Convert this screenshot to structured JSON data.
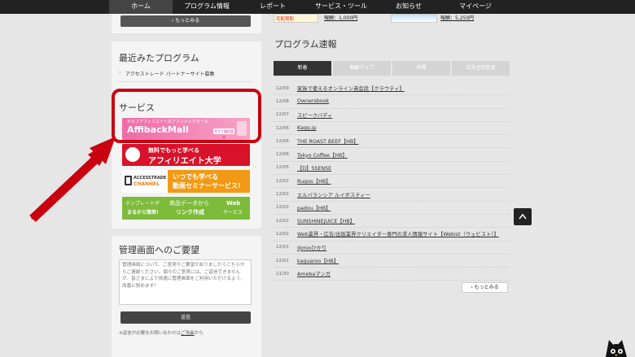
{
  "nav": {
    "items": [
      {
        "label": "ホーム",
        "active": true
      },
      {
        "label": "プログラム情報"
      },
      {
        "label": "レポート"
      },
      {
        "label": "サービス・ツール"
      },
      {
        "label": "お知らせ"
      },
      {
        "label": "マイページ"
      }
    ]
  },
  "top_strip": {
    "left_thumb_text": "宅配買取",
    "left_price": "報酬：1,000円",
    "right_price": "報酬：5,250円"
  },
  "left": {
    "top_more": "もっとみる",
    "recent_title": "最近みたプログラム",
    "recent_item": "アクセストレード パートナーサイト募集",
    "services_title": "サービス",
    "banners": {
      "affiback": {
        "tagline": "セルフアフィリエイトのアフィバックモール",
        "logo": "AffibackMall",
        "cta": "今すぐ無料登録"
      },
      "university": {
        "line1": "無料でもっと学べる",
        "line2": "アフィリエイト大学"
      },
      "channel": {
        "brand1": "ACCESSTRADE",
        "brand2": "CHANNEL",
        "line1": "いつでも学べる",
        "line2": "動画セミナーサービス!"
      },
      "web": {
        "line1": "テンプレートが",
        "line2": "まるから簡単!",
        "line3": "商品データから",
        "line4": "リンク作成",
        "tag": "Web",
        "tag2": "サービス"
      }
    },
    "feedback_title": "管理画面へのご要望",
    "feedback_placeholder": "管理画面について、ご意見やご要望がありましたらこちらからご連絡ください。個々のご意見には、ご返信できませんが、皆さまにより快適に管理画面をご利用いただけるよう、改善に努めます！",
    "submit_label": "送信",
    "note_prefix": "※返信が必要なお問い合わせは",
    "note_link": "ご当会",
    "note_suffix": "から"
  },
  "right": {
    "title": "プログラム速報",
    "tabs": [
      "新着",
      "報酬アップ",
      "再開",
      "広告主特定表"
    ],
    "news": [
      {
        "date": "12/09",
        "name": "家族で使えるオンライン英会話【クラウティ】"
      },
      {
        "date": "12/08",
        "name": "Ownersbook"
      },
      {
        "date": "12/07",
        "name": "スピークバディ"
      },
      {
        "date": "12/06",
        "name": "Kagg.jp"
      },
      {
        "date": "12/06",
        "name": "THE ROAST BEEF【HB】"
      },
      {
        "date": "12/06",
        "name": "Tokyo Coffee【HB】"
      },
      {
        "date": "12/05",
        "name": "【D】SSENSE"
      },
      {
        "date": "12/02",
        "name": "Rugoo【HB】"
      },
      {
        "date": "12/02",
        "name": "エルバランシア ルイボスティー"
      },
      {
        "date": "12/02",
        "name": "padou【HB】"
      },
      {
        "date": "12/02",
        "name": "SUNSHINEJUICE【HB】"
      },
      {
        "date": "12/02",
        "name": "Web業界・広告/出版業界クリエイター専門の求人情報サイト【Webist（ウェビスト）】"
      },
      {
        "date": "12/01",
        "name": "IIJmioひかり"
      },
      {
        "date": "12/01",
        "name": "kaguaroo【HB】"
      },
      {
        "date": "11/30",
        "name": "Amebaマンガ"
      }
    ],
    "more": "もっとみる"
  },
  "colors": {
    "highlight_frame": "#c8000f",
    "arrow": "#c8000f",
    "nav_bg": "#222222"
  }
}
